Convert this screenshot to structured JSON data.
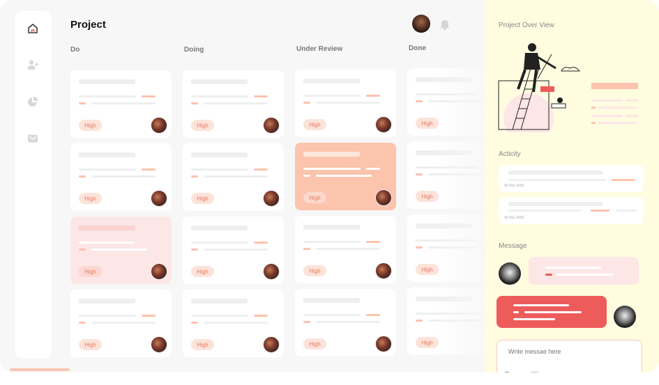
{
  "header": {
    "title": "Project"
  },
  "columns": [
    {
      "title": "Do",
      "cards": [
        {
          "priority": "High"
        },
        {
          "priority": "High"
        },
        {
          "priority": "High"
        },
        {
          "priority": "High"
        }
      ]
    },
    {
      "title": "Doing",
      "cards": [
        {
          "priority": "High"
        },
        {
          "priority": "High"
        },
        {
          "priority": "High"
        },
        {
          "priority": "High"
        }
      ]
    },
    {
      "title": "Under Review",
      "cards": [
        {
          "priority": "High"
        },
        {
          "priority": "High"
        },
        {
          "priority": "High"
        },
        {
          "priority": "High"
        }
      ]
    },
    {
      "title": "Done",
      "cards": [
        {
          "priority": "High"
        },
        {
          "priority": "High"
        },
        {
          "priority": "High"
        },
        {
          "priority": "High"
        }
      ]
    }
  ],
  "panel": {
    "overview_label": "Project Over View",
    "activity_label": "Acticity",
    "activities": [
      {
        "date": "30 Nov 2020"
      },
      {
        "date": "30 Nov 2020"
      }
    ],
    "message_label": "Message",
    "input_placeholder": "Write messae here"
  },
  "icons": [
    "home-icon",
    "add-user-icon",
    "pie-chart-icon",
    "mail-icon",
    "bell-icon",
    "emoji-icon",
    "link-icon",
    "image-icon"
  ],
  "colors": {
    "accent": "#ee5b5b",
    "salmon": "#fcc3ad",
    "pink": "#fce6e6",
    "panel": "#fffce0",
    "badge_text": "#e8785c"
  }
}
